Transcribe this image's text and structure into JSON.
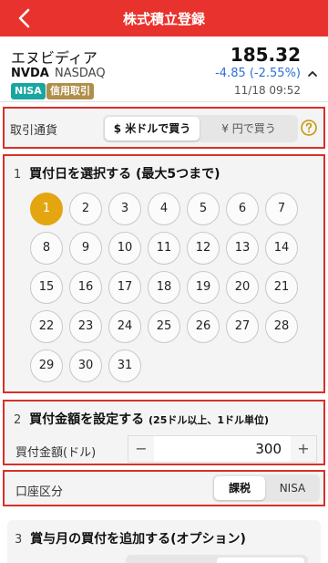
{
  "header": {
    "title": "株式積立登録",
    "back_icon": "chevron-left-icon",
    "color": "#e8322d"
  },
  "stock": {
    "name": "エヌビディア",
    "ticker": "NVDA",
    "exchange": "NASDAQ",
    "badges": [
      "NISA",
      "信用取引"
    ],
    "price": "185.32",
    "change": "-4.85 (-2.55%)",
    "updated": "11/18 09:52",
    "change_color": "#2d6fd8"
  },
  "currency": {
    "label": "取引通貨",
    "options": [
      "$ 米ドルで買う",
      "¥ 円で買う"
    ],
    "selected": "$ 米ドルで買う",
    "help_icon": "question-circle-icon"
  },
  "date_section": {
    "number": "1",
    "title": "買付日を選択する",
    "subtitle": "(最大5つまで)",
    "days": [
      "1",
      "2",
      "3",
      "4",
      "5",
      "6",
      "7",
      "8",
      "9",
      "10",
      "11",
      "12",
      "13",
      "14",
      "15",
      "16",
      "17",
      "18",
      "19",
      "20",
      "21",
      "22",
      "23",
      "24",
      "25",
      "26",
      "27",
      "28",
      "29",
      "30",
      "31"
    ],
    "selected_days": [
      "1"
    ],
    "selected_color": "#e3a611"
  },
  "amount_section": {
    "number": "2",
    "title": "買付金額を設定する",
    "subtitle": "(25ドル以上、1ドル単位)",
    "field_label": "買付金額(ドル)",
    "minus": "−",
    "plus": "+",
    "value": "300"
  },
  "account_section": {
    "label": "口座区分",
    "options": [
      "課税",
      "NISA"
    ],
    "selected": "課税"
  },
  "bonus_section": {
    "number": "3",
    "title": "賞与月の買付を追加する(オプション)"
  },
  "highlight_color": "#d9302a"
}
